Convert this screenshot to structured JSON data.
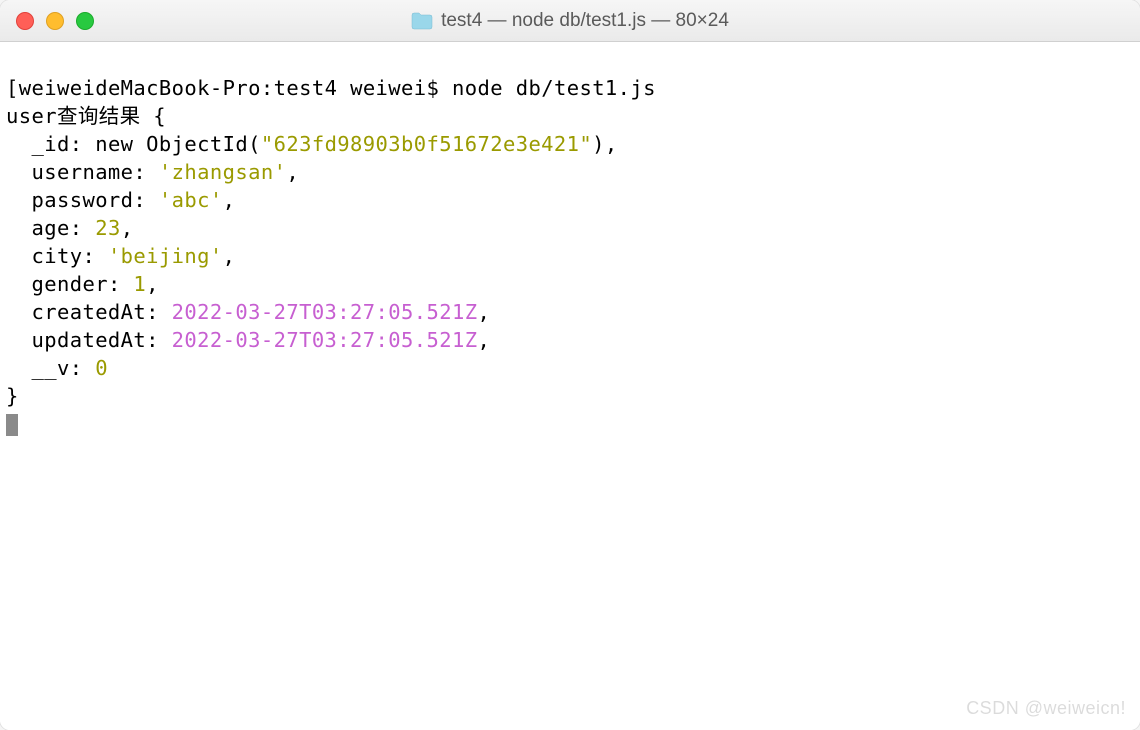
{
  "titlebar": {
    "folder_icon": "folder-icon",
    "title": "test4 — node db/test1.js — 80×24"
  },
  "terminal": {
    "prompt_open": "[",
    "host": "weiweideMacBook-Pro",
    "sep1": ":",
    "cwd": "test4",
    "user": "weiwei",
    "prompt_sign": "$",
    "command": "node db/test1.js",
    "output": {
      "header": "user查询结果 {",
      "fields": {
        "id_key": "_id",
        "id_val_prefix": "new ObjectId(",
        "id_val_str": "\"623fd98903b0f51672e3e421\"",
        "id_val_suffix": ")",
        "username_key": "username",
        "username_val": "'zhangsan'",
        "password_key": "password",
        "password_val": "'abc'",
        "age_key": "age",
        "age_val": "23",
        "city_key": "city",
        "city_val": "'beijing'",
        "gender_key": "gender",
        "gender_val": "1",
        "createdAt_key": "createdAt",
        "createdAt_val": "2022-03-27T03:27:05.521Z",
        "updatedAt_key": "updatedAt",
        "updatedAt_val": "2022-03-27T03:27:05.521Z",
        "v_key": "__v",
        "v_val": "0"
      },
      "close": "}"
    },
    "bracket_close": "]"
  },
  "watermark": "CSDN @weiweicn!"
}
